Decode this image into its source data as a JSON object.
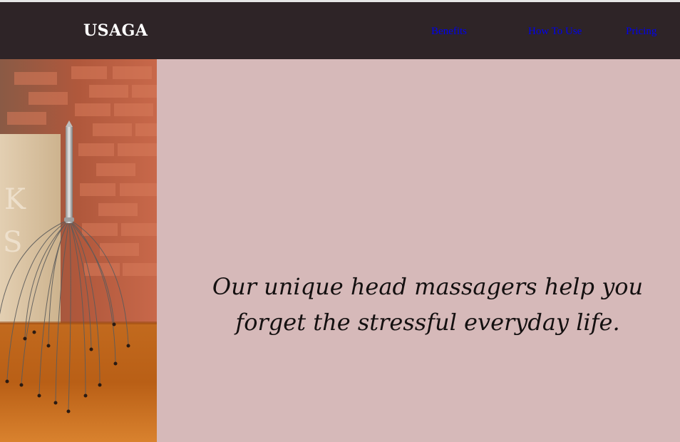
{
  "header": {
    "brand": "USAGA",
    "nav": [
      {
        "label": "Benefits"
      },
      {
        "label": "How To Use"
      },
      {
        "label": "Pricing"
      }
    ],
    "background_color": "#2e2427",
    "link_color": "#0000ee"
  },
  "hero": {
    "image_subject": "head-massager-photo",
    "tagline_line1": "Our unique head massagers help you",
    "tagline_line2": "forget the stressful everyday life.",
    "panel_color": "#d6b9b9"
  }
}
